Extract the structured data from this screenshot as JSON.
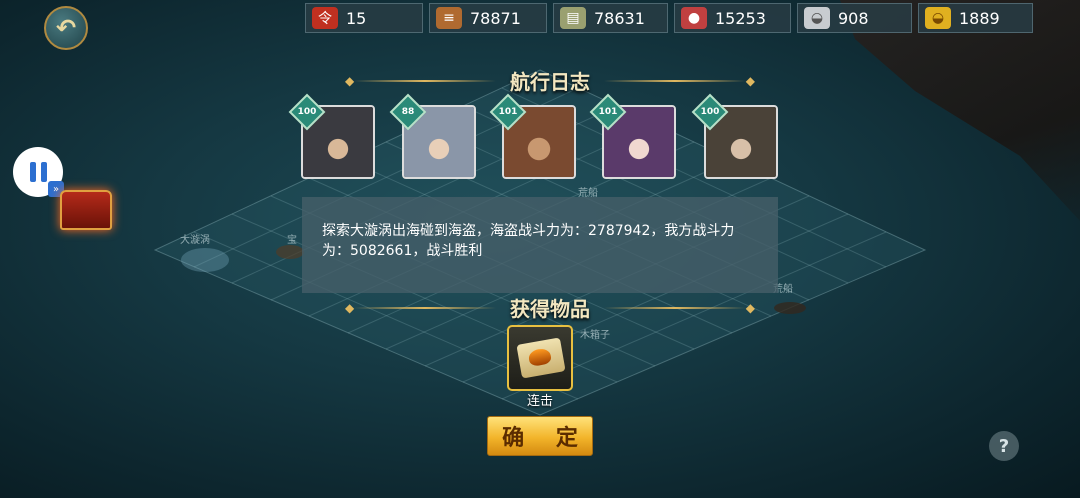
{
  "resources": [
    {
      "icon": "token-icon",
      "value": "15",
      "color": "#c03020"
    },
    {
      "icon": "wood-icon",
      "value": "78871",
      "color": "#b06a30"
    },
    {
      "icon": "stone-icon",
      "value": "78631",
      "color": "#9aa070"
    },
    {
      "icon": "meat-icon",
      "value": "15253",
      "color": "#c04040"
    },
    {
      "icon": "silver-icon",
      "value": "908",
      "color": "#c8ccd0"
    },
    {
      "icon": "gold-icon",
      "value": "1889",
      "color": "#e0b020"
    }
  ],
  "log_title": "航行日志",
  "heroes": [
    {
      "level": "100",
      "color": "#3a3a40"
    },
    {
      "level": "88",
      "color": "#8a96a8"
    },
    {
      "level": "101",
      "color": "#7a4a30"
    },
    {
      "level": "101",
      "color": "#5a3a6a"
    },
    {
      "level": "100",
      "color": "#4a4238"
    }
  ],
  "message": "探索大漩涡出海碰到海盗，海盗战斗力为：2787942，我方战斗力为：5082661，战斗胜利",
  "rewards_title": "获得物品",
  "reward_item": {
    "name": "连击",
    "icon": "scroll-icon"
  },
  "confirm_label": "确 定",
  "help_label": "?",
  "map_labels": [
    "大漩涡",
    "宝",
    "荒船",
    "荒船",
    "木箱子"
  ]
}
